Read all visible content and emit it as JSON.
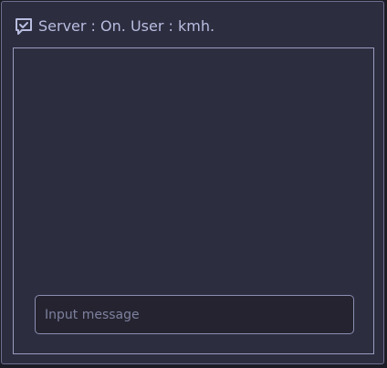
{
  "header": {
    "title": "Server : On. User : kmh.",
    "icon": "chat-check-icon"
  },
  "chat": {
    "messages": []
  },
  "input": {
    "placeholder": "Input message",
    "value": ""
  },
  "colors": {
    "panel_bg": "#2c2d3f",
    "border": "#9a9cc0",
    "text": "#b9bde0",
    "input_bg": "#24232f"
  }
}
